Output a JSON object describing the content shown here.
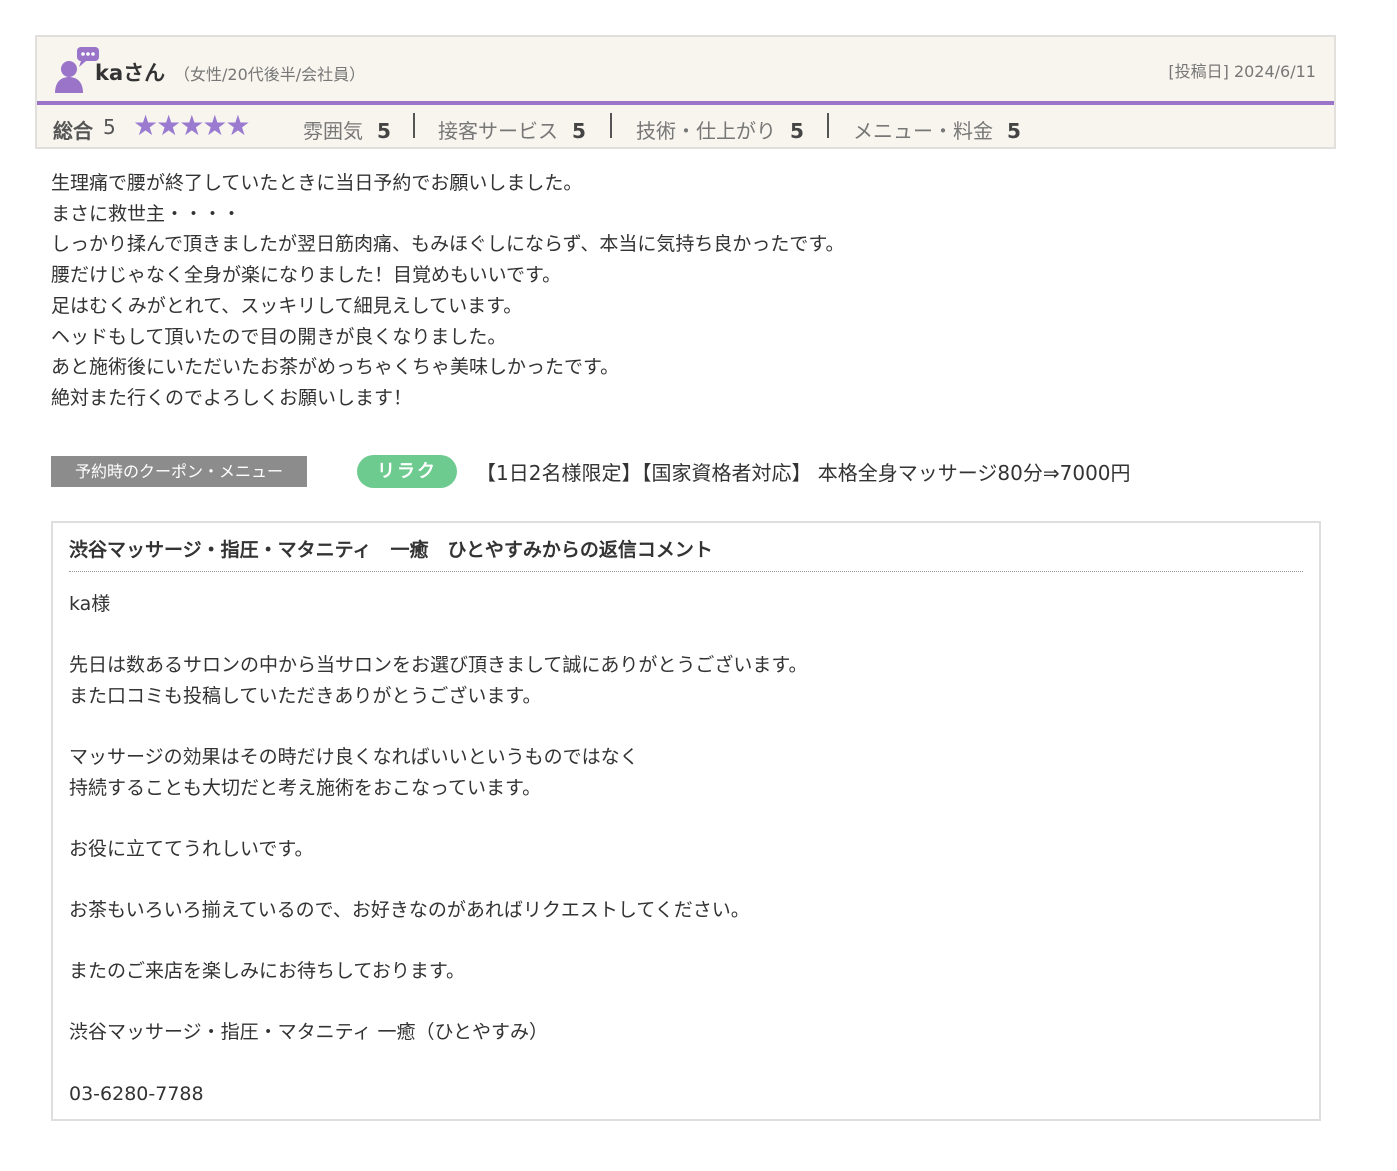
{
  "review": {
    "user_name": "kaさん",
    "user_meta": "（女性/20代後半/会社員）",
    "post_date": "[投稿日] 2024/6/11",
    "overall_label": "総合",
    "overall_score": "5",
    "stars": "★★★★★",
    "star_rating": 5,
    "categories": [
      {
        "label": "雰囲気",
        "value": "5"
      },
      {
        "label": "接客サービス",
        "value": "5"
      },
      {
        "label": "技術・仕上がり",
        "value": "5"
      },
      {
        "label": "メニュー・料金",
        "value": "5"
      }
    ],
    "body_lines": [
      "生理痛で腰が終了していたときに当日予約でお願いしました。",
      "まさに救世主・・・・",
      "しっかり揉んで頂きましたが翌日筋肉痛、もみほぐしにならず、本当に気持ち良かったです。",
      "腰だけじゃなく全身が楽になりました！目覚めもいいです。",
      "足はむくみがとれて、スッキリして細見えしています。",
      "ヘッドもして頂いたので目の開きが良くなりました。",
      "あと施術後にいただいたお茶がめっちゃくちゃ美味しかったです。",
      "絶対また行くのでよろしくお願いします！"
    ]
  },
  "coupon": {
    "label": "予約時のクーポン・メニュー",
    "tag": "リラク",
    "text": "【1日2名様限定】【国家資格者対応】 本格全身マッサージ80分⇒7000円"
  },
  "reply": {
    "title": "渋谷マッサージ・指圧・マタニティ　一癒　ひとやすみからの返信コメント",
    "body_lines": [
      "ka様",
      "",
      "先日は数あるサロンの中から当サロンをお選び頂きまして誠にありがとうございます。",
      "また口コミも投稿していただきありがとうございます。",
      "",
      "マッサージの効果はその時だけ良くなればいいというものではなく",
      "持続することも大切だと考え施術をおこなっています。",
      "",
      "お役に立ててうれしいです。",
      "",
      "お茶もいろいろ揃えているので、お好きなのがあればリクエストしてください。",
      "",
      "またのご来店を楽しみにお待ちしております。",
      "",
      "渋谷マッサージ・指圧・マタニティ 一癒（ひとやすみ）",
      "",
      "03-6280-7788"
    ]
  },
  "colors": {
    "accent_purple": "#9a74c8",
    "star_color": "#9a7bd0",
    "tag_green": "#6dcb8f",
    "header_bg": "#f7f5ee"
  }
}
